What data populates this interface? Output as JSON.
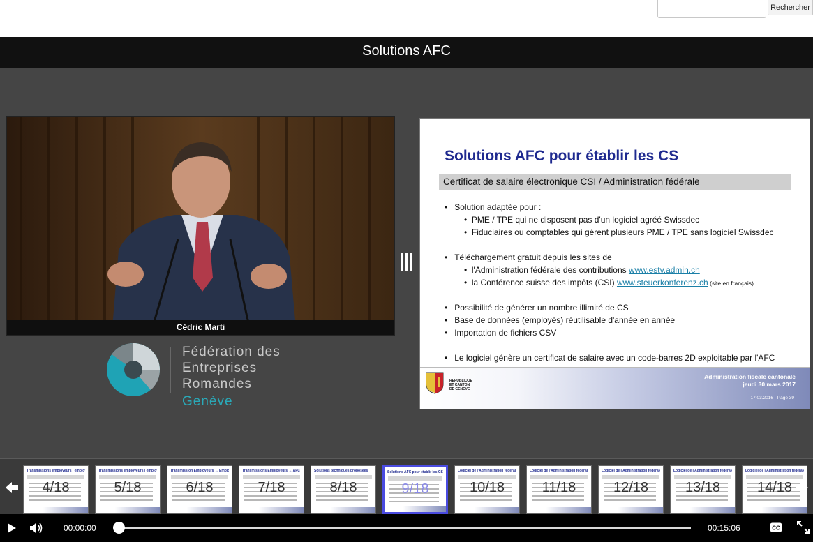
{
  "search": {
    "placeholder": "",
    "button_label": "Rechercher"
  },
  "player": {
    "title": "Solutions AFC",
    "speaker": "Cédric Marti",
    "logo": {
      "line1": "Fédération des",
      "line2": "Entreprises",
      "line3": "Romandes",
      "line4": "Genève"
    },
    "slide": {
      "title": "Solutions AFC pour établir les CS",
      "subtitle": "Certificat de salaire électronique CSI / Administration fédérale",
      "b1": "Solution adaptée pour :",
      "b1a": "PME / TPE qui ne disposent pas d'un logiciel agréé Swissdec",
      "b1b": "Fiduciaires ou comptables qui gèrent plusieurs PME / TPE sans logiciel Swissdec",
      "b2": "Téléchargement gratuit depuis les sites de",
      "b2a_text": "l'Administration fédérale des contributions ",
      "b2a_link": "www.estv.admin.ch",
      "b2b_text": "la Conférence suisse des impôts (CSI) ",
      "b2b_link": "www.steuerkonferenz.ch",
      "b2b_note": " (site en français)",
      "b3": "Possibilité de générer un nombre illimité de CS",
      "b4": "Base de données (employés) réutilisable d'année en année",
      "b5": "Importation de fichiers CSV",
      "b6": "Le logiciel génère un certificat de salaire avec un code-barres 2D exploitable par l'AFC",
      "footer_line1": "Administration fiscale cantonale",
      "footer_line2": "jeudi 30 mars 2017",
      "footer_page": "17.03.2016 - Page 39",
      "coat_text1": "REPUBLIQUE",
      "coat_text2": "ET CANTON",
      "coat_text3": "DE GENEVE"
    },
    "thumbnails": [
      {
        "label": "4/18",
        "title": "Transmissions employeurs / employés / AFC"
      },
      {
        "label": "5/18",
        "title": "Transmissions employeurs / employés / AFC"
      },
      {
        "label": "6/18",
        "title": "Transmission Employeurs → Employés"
      },
      {
        "label": "7/18",
        "title": "Transmissions Employeurs → AFC"
      },
      {
        "label": "8/18",
        "title": "Solutions techniques proposées"
      },
      {
        "label": "9/18",
        "title": "Solutions AFC pour établir les CS"
      },
      {
        "label": "10/18",
        "title": "Logiciel de l'Administration fédérale"
      },
      {
        "label": "11/18",
        "title": "Logiciel de l'Administration fédérale"
      },
      {
        "label": "12/18",
        "title": "Logiciel de l'Administration fédérale"
      },
      {
        "label": "13/18",
        "title": "Logiciel de l'Administration fédérale"
      },
      {
        "label": "14/18",
        "title": "Logiciel de l'Administration fédérale"
      }
    ],
    "active_thumbnail": "9/18",
    "controls": {
      "time_current": "00:00:00",
      "time_total": "00:15:06",
      "progress": 0.0
    },
    "icons": [
      "play-icon",
      "volume-icon",
      "closed-captions-icon",
      "fullscreen-icon",
      "arrow-left-icon",
      "arrow-right-icon",
      "splitter-icon"
    ]
  }
}
